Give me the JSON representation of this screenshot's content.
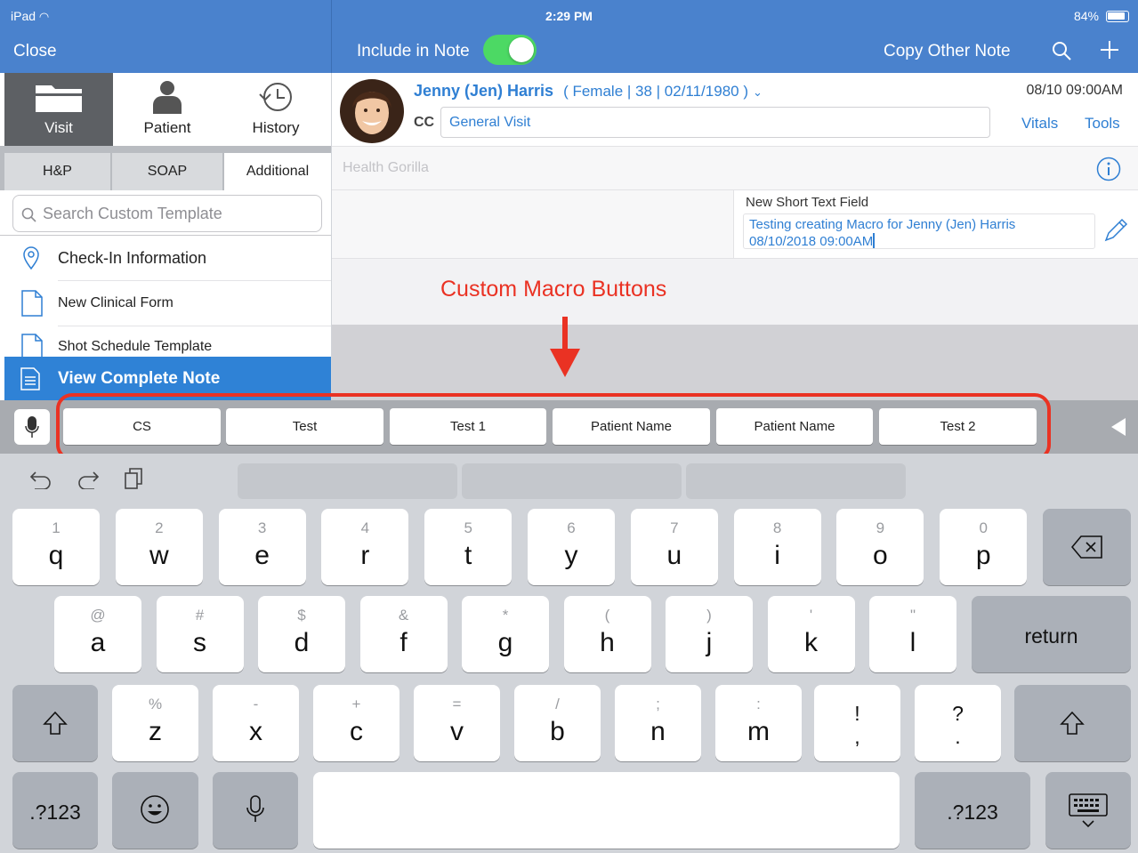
{
  "status": {
    "device": "iPad",
    "time": "2:29 PM",
    "battery": "84%"
  },
  "nav": {
    "close": "Close",
    "include_in_note": "Include in Note",
    "copy_other_note": "Copy Other Note"
  },
  "left": {
    "tabs": [
      {
        "label": "Visit"
      },
      {
        "label": "Patient"
      },
      {
        "label": "History"
      }
    ],
    "segments": [
      "H&P",
      "SOAP",
      "Additional"
    ],
    "search_placeholder": "Search Custom Template",
    "items": [
      "Check-In Information",
      "New Clinical Form",
      "Shot Schedule Template"
    ],
    "view_complete_note": "View Complete Note"
  },
  "patient": {
    "name": "Jenny (Jen) Harris",
    "details": "( Female | 38 | 02/11/1980 )",
    "datetime": "08/10 09:00AM",
    "cc_label": "CC",
    "cc_value": "General Visit",
    "vitals": "Vitals",
    "tools": "Tools"
  },
  "note": {
    "section": "Health Gorilla",
    "field_label": "New Short Text Field",
    "field_value_line1": "Testing creating Macro for Jenny (Jen) Harris",
    "field_value_line2": "08/10/2018 09:00AM"
  },
  "annotation": {
    "label": "Custom Macro Buttons",
    "color": "#ea3223"
  },
  "macros": [
    "CS",
    "Test",
    "Test 1",
    "Patient Name",
    "Patient Name",
    "Test 2"
  ],
  "keyboard": {
    "row1": [
      {
        "sub": "1",
        "main": "q"
      },
      {
        "sub": "2",
        "main": "w"
      },
      {
        "sub": "3",
        "main": "e"
      },
      {
        "sub": "4",
        "main": "r"
      },
      {
        "sub": "5",
        "main": "t"
      },
      {
        "sub": "6",
        "main": "y"
      },
      {
        "sub": "7",
        "main": "u"
      },
      {
        "sub": "8",
        "main": "i"
      },
      {
        "sub": "9",
        "main": "o"
      },
      {
        "sub": "0",
        "main": "p"
      }
    ],
    "row2": [
      {
        "sub": "@",
        "main": "a"
      },
      {
        "sub": "#",
        "main": "s"
      },
      {
        "sub": "$",
        "main": "d"
      },
      {
        "sub": "&",
        "main": "f"
      },
      {
        "sub": "*",
        "main": "g"
      },
      {
        "sub": "(",
        "main": "h"
      },
      {
        "sub": ")",
        "main": "j"
      },
      {
        "sub": "'",
        "main": "k"
      },
      {
        "sub": "\"",
        "main": "l"
      }
    ],
    "row3": [
      {
        "sub": "%",
        "main": "z"
      },
      {
        "sub": "-",
        "main": "x"
      },
      {
        "sub": "+",
        "main": "c"
      },
      {
        "sub": "=",
        "main": "v"
      },
      {
        "sub": "/",
        "main": "b"
      },
      {
        "sub": ";",
        "main": "n"
      },
      {
        "sub": ":",
        "main": "m"
      }
    ],
    "punct1": {
      "top": "!",
      "bottom": ","
    },
    "punct2": {
      "top": "?",
      "bottom": "."
    },
    "return": "return",
    "numbers": ".?123"
  },
  "colors": {
    "nav_blue": "#4a82cd",
    "link_blue": "#2f7fd3",
    "toggle_green": "#4cd964",
    "selected_blue": "#2f82d6"
  }
}
